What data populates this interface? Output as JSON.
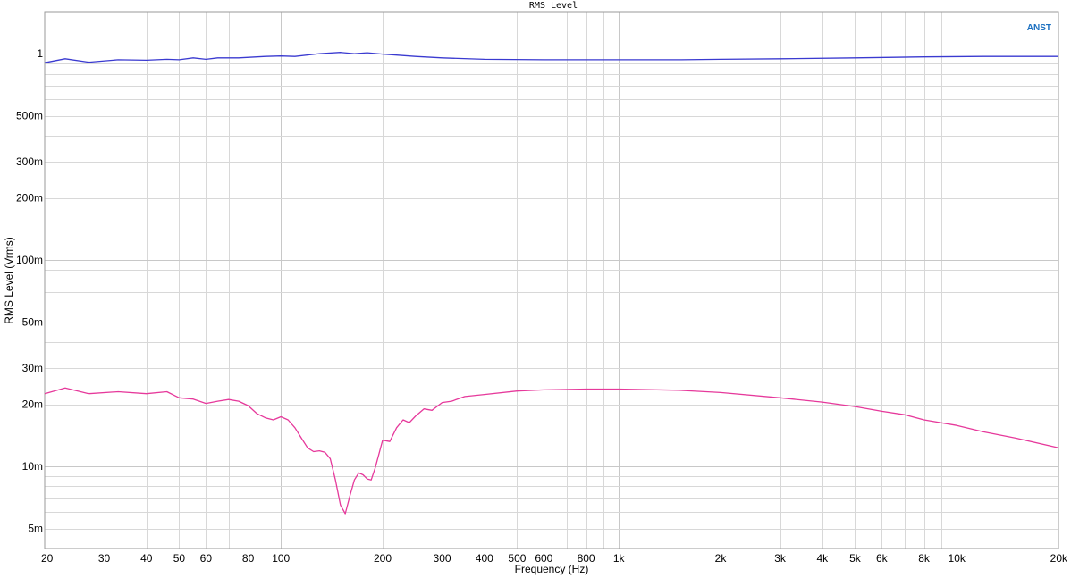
{
  "chart_data": {
    "type": "line",
    "title": "RMS Level",
    "xlabel": "Frequency (Hz)",
    "ylabel": "RMS Level (Vrms)",
    "brand": "ANST",
    "x_scale": "log",
    "y_scale": "log",
    "xlim": [
      20,
      20000
    ],
    "ylim": [
      0.004,
      1.6
    ],
    "grid": true,
    "x_ticks": [
      {
        "value": 20,
        "label": "20"
      },
      {
        "value": 30,
        "label": "30"
      },
      {
        "value": 40,
        "label": "40"
      },
      {
        "value": 50,
        "label": "50"
      },
      {
        "value": 60,
        "label": "60"
      },
      {
        "value": 80,
        "label": "80"
      },
      {
        "value": 100,
        "label": "100"
      },
      {
        "value": 200,
        "label": "200"
      },
      {
        "value": 300,
        "label": "300"
      },
      {
        "value": 400,
        "label": "400"
      },
      {
        "value": 500,
        "label": "500"
      },
      {
        "value": 600,
        "label": "600"
      },
      {
        "value": 800,
        "label": "800"
      },
      {
        "value": 1000,
        "label": "1k"
      },
      {
        "value": 2000,
        "label": "2k"
      },
      {
        "value": 3000,
        "label": "3k"
      },
      {
        "value": 4000,
        "label": "4k"
      },
      {
        "value": 5000,
        "label": "5k"
      },
      {
        "value": 6000,
        "label": "6k"
      },
      {
        "value": 8000,
        "label": "8k"
      },
      {
        "value": 10000,
        "label": "10k"
      },
      {
        "value": 20000,
        "label": "20k"
      }
    ],
    "y_ticks": [
      {
        "value": 1,
        "label": "1"
      },
      {
        "value": 0.5,
        "label": "500m"
      },
      {
        "value": 0.3,
        "label": "300m"
      },
      {
        "value": 0.2,
        "label": "200m"
      },
      {
        "value": 0.1,
        "label": "100m"
      },
      {
        "value": 0.05,
        "label": "50m"
      },
      {
        "value": 0.03,
        "label": "30m"
      },
      {
        "value": 0.02,
        "label": "20m"
      },
      {
        "value": 0.01,
        "label": "10m"
      },
      {
        "value": 0.005,
        "label": "5m"
      }
    ],
    "series": [
      {
        "color": "#3a3ad0",
        "x": [
          20,
          23,
          27,
          33,
          40,
          46,
          50,
          55,
          60,
          65,
          75,
          90,
          100,
          110,
          130,
          150,
          165,
          180,
          200,
          220,
          250,
          300,
          400,
          600,
          1000,
          1500,
          2000,
          3000,
          5000,
          8000,
          12000,
          20000
        ],
        "y": [
          0.905,
          0.945,
          0.91,
          0.935,
          0.93,
          0.94,
          0.935,
          0.955,
          0.94,
          0.955,
          0.955,
          0.97,
          0.975,
          0.97,
          1.0,
          1.015,
          1.0,
          1.01,
          0.995,
          0.985,
          0.97,
          0.955,
          0.94,
          0.935,
          0.935,
          0.935,
          0.94,
          0.945,
          0.955,
          0.965,
          0.97,
          0.97
        ]
      },
      {
        "color": "#e6399b",
        "x": [
          20,
          23,
          27,
          33,
          40,
          46,
          50,
          55,
          60,
          65,
          70,
          75,
          80,
          85,
          90,
          95,
          100,
          105,
          110,
          115,
          120,
          125,
          130,
          135,
          140,
          145,
          150,
          155,
          160,
          165,
          170,
          175,
          180,
          185,
          190,
          200,
          210,
          220,
          230,
          240,
          250,
          265,
          280,
          300,
          320,
          350,
          400,
          500,
          600,
          800,
          1000,
          1500,
          2000,
          3000,
          4000,
          5000,
          6000,
          7000,
          8000,
          10000,
          12000,
          15000,
          20000
        ],
        "y": [
          0.0225,
          0.024,
          0.0225,
          0.023,
          0.0225,
          0.023,
          0.0215,
          0.0212,
          0.0202,
          0.0207,
          0.0211,
          0.0207,
          0.0197,
          0.018,
          0.0172,
          0.0168,
          0.0174,
          0.0168,
          0.0154,
          0.0137,
          0.0123,
          0.0118,
          0.0119,
          0.0117,
          0.0109,
          0.0086,
          0.0065,
          0.0059,
          0.0072,
          0.0086,
          0.0093,
          0.0091,
          0.0087,
          0.0086,
          0.0098,
          0.0134,
          0.0132,
          0.0154,
          0.0168,
          0.0163,
          0.0175,
          0.019,
          0.0187,
          0.0204,
          0.0207,
          0.0218,
          0.0223,
          0.0232,
          0.0235,
          0.0237,
          0.0237,
          0.0234,
          0.0228,
          0.0215,
          0.0205,
          0.0195,
          0.0185,
          0.0178,
          0.0168,
          0.0158,
          0.0147,
          0.0137,
          0.0123
        ]
      }
    ]
  }
}
